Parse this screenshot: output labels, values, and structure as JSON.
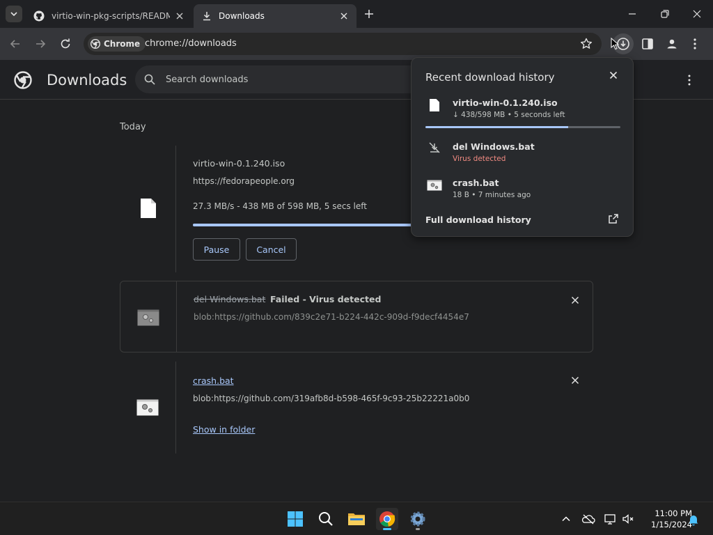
{
  "tabs": [
    {
      "title": "virtio-win-pkg-scripts/README",
      "active": false
    },
    {
      "title": "Downloads",
      "active": true
    }
  ],
  "toolbar": {
    "chip_label": "Chrome",
    "url": "chrome://downloads"
  },
  "page": {
    "title": "Downloads",
    "search_placeholder": "Search downloads",
    "section_label": "Today"
  },
  "downloads": [
    {
      "filename": "virtio-win-0.1.240.iso",
      "source": "https://fedorapeople.org",
      "status": "27.3 MB/s - 438 MB of 598 MB, 5 secs left",
      "progress": 0.732,
      "pause_label": "Pause",
      "cancel_label": "Cancel"
    },
    {
      "filename": "del Windows.bat",
      "status": "Failed - Virus detected",
      "source": "blob:https://github.com/839c2e71-b224-442c-909d-f9decf4454e7"
    },
    {
      "filename": "crash.bat",
      "source": "blob:https://github.com/319afb8d-b598-465f-9c93-25b22221a0b0",
      "show_in_folder": "Show in folder"
    }
  ],
  "bubble": {
    "title": "Recent download history",
    "items": [
      {
        "name": "virtio-win-0.1.240.iso",
        "sub": "↓ 438/598 MB • 5 seconds left",
        "progress": 0.732
      },
      {
        "name": "del Windows.bat",
        "sub": "Virus detected"
      },
      {
        "name": "crash.bat",
        "sub": "18 B • 7 minutes ago"
      }
    ],
    "full_history": "Full download history"
  },
  "taskbar": {
    "time": "11:00 PM",
    "date": "1/15/2024"
  },
  "colors": {
    "accent": "#a8c7fa",
    "danger": "#f28b82",
    "link": "#a8c7fa"
  }
}
